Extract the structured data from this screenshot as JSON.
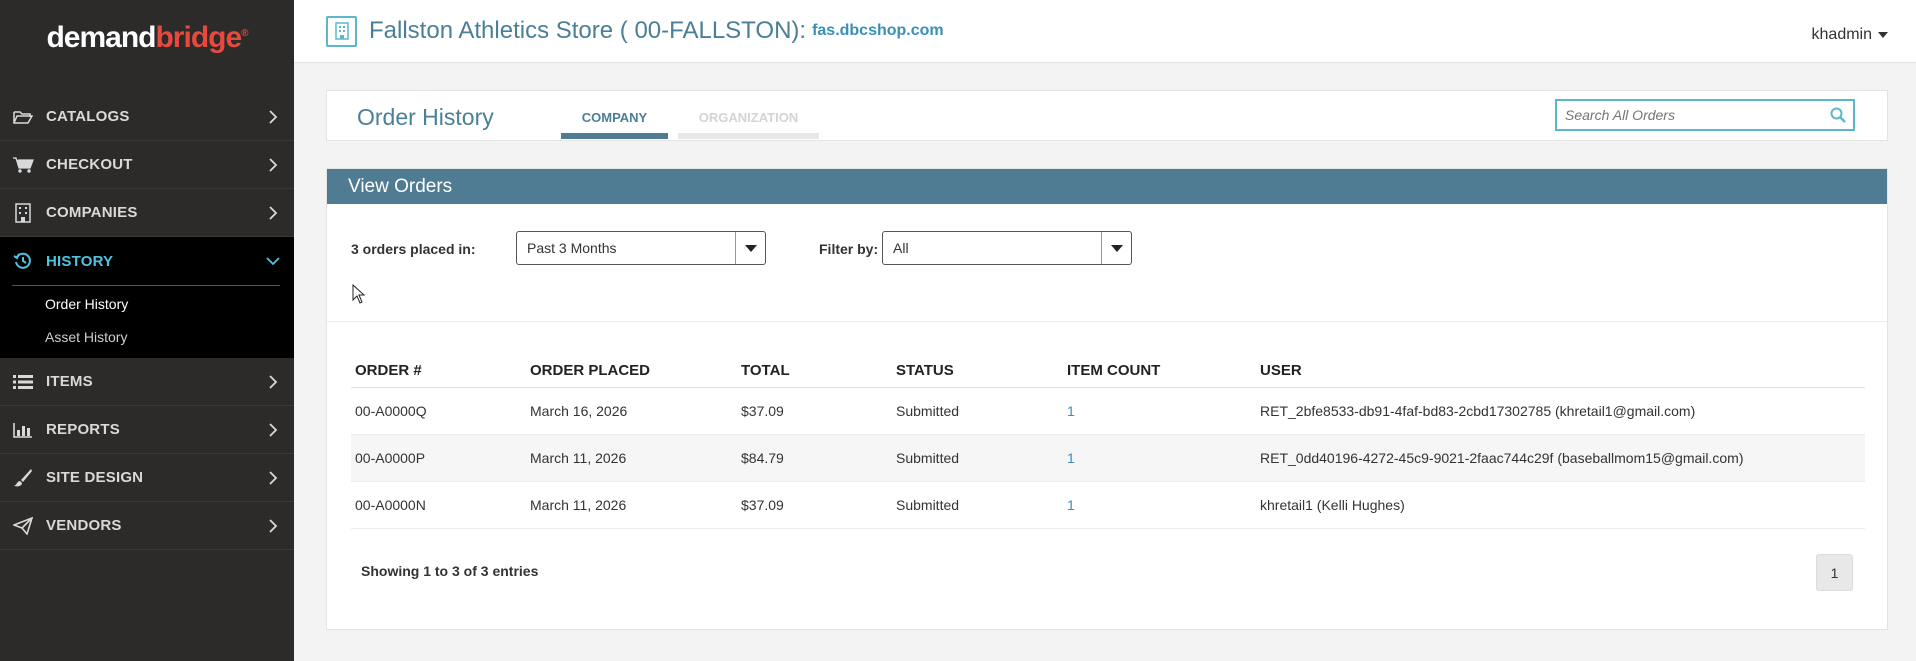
{
  "logo": {
    "part1": "demand",
    "part2": "bridge",
    "mark": "®"
  },
  "sidebar": {
    "items": [
      {
        "label": "CATALOGS",
        "icon": "folder-open-icon"
      },
      {
        "label": "CHECKOUT",
        "icon": "cart-icon"
      },
      {
        "label": "COMPANIES",
        "icon": "building-icon"
      },
      {
        "label": "HISTORY",
        "icon": "history-icon"
      },
      {
        "label": "ITEMS",
        "icon": "list-icon"
      },
      {
        "label": "REPORTS",
        "icon": "bar-chart-icon"
      },
      {
        "label": "SITE DESIGN",
        "icon": "brush-icon"
      },
      {
        "label": "VENDORS",
        "icon": "paper-plane-icon"
      }
    ],
    "history_sub": [
      "Order History",
      "Asset History"
    ]
  },
  "topbar": {
    "store_title": "Fallston Athletics Store ( 00-FALLSTON):",
    "store_domain": "fas.dbcshop.com",
    "user": "khadmin"
  },
  "header": {
    "title": "Order History",
    "tabs": [
      "COMPANY",
      "ORGANIZATION"
    ],
    "search_placeholder": "Search All Orders"
  },
  "panel": {
    "title": "View Orders",
    "orders_label": "3 orders placed in:",
    "range_value": "Past 3 Months",
    "filter_label": "Filter by:",
    "filter_value": "All",
    "columns": [
      "ORDER #",
      "ORDER PLACED",
      "TOTAL",
      "STATUS",
      "ITEM COUNT",
      "USER"
    ],
    "rows": [
      [
        "00-A0000Q",
        "March 16, 2026",
        "$37.09",
        "Submitted",
        "1",
        "RET_2bfe8533-db91-4faf-bd83-2cbd17302785 (khretail1@gmail.com)"
      ],
      [
        "00-A0000P",
        "March 11, 2026",
        "$84.79",
        "Submitted",
        "1",
        "RET_0dd40196-4272-45c9-9021-2faac744c29f (baseballmom15@gmail.com)"
      ],
      [
        "00-A0000N",
        "March 11, 2026",
        "$37.09",
        "Submitted",
        "1",
        "khretail1 (Kelli Hughes)"
      ]
    ],
    "showing": "Showing 1 to 3 of 3 entries",
    "page": "1"
  },
  "colors": {
    "accent": "#4fc3e0",
    "panel_header": "#4f7b93",
    "logo_red": "#e8493f"
  }
}
